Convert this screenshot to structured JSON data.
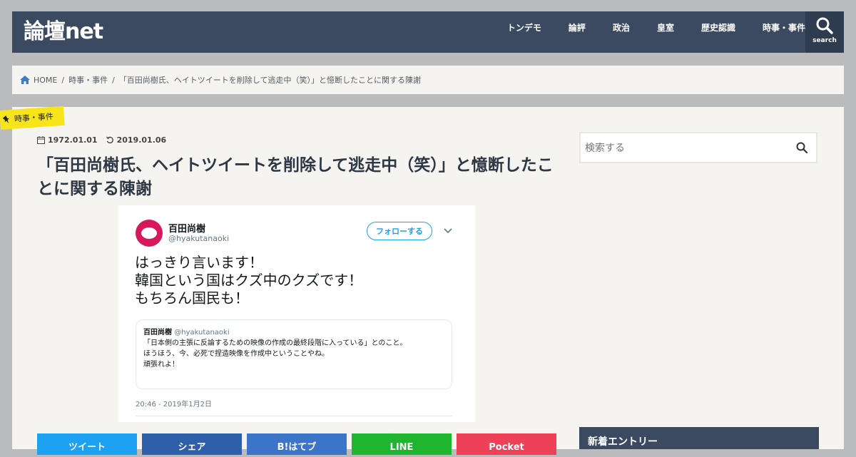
{
  "site": {
    "logo": "論壇net"
  },
  "nav": {
    "items": [
      "トンデモ",
      "論評",
      "政治",
      "皇室",
      "歴史認識",
      "時事・事件"
    ],
    "search_label": "search"
  },
  "breadcrumb": {
    "home": "HOME",
    "category": "時事・事件",
    "current": "「百田尚樹氏、ヘイトツイートを削除して逃走中（笑）」と憶断したことに関する陳謝"
  },
  "article": {
    "category": "時事・事件",
    "published": "1972.01.01",
    "updated": "2019.01.06",
    "title": "「百田尚樹氏、ヘイトツイートを削除して逃走中（笑）」と憶断したことに関する陳謝"
  },
  "tweet": {
    "name": "百田尚樹",
    "handle": "@hyakutanaoki",
    "follow_label": "フォローする",
    "lines": [
      "はっきり言います！",
      "韓国という国はクズ中のクズです！",
      "もちろん国民も！"
    ],
    "quote": {
      "name": "百田尚樹",
      "handle": "@hyakutanaoki",
      "lines": [
        "「日本側の主張に反論するための映像の作成の最終段階に入っている」とのこと。",
        "ほうほう、今、必死で捏造映像を作成中ということやね。",
        "頑張れよ！"
      ]
    },
    "timestamp": "20:46 - 2019年1月2日"
  },
  "share": {
    "buttons": [
      {
        "label": "ツイート",
        "color": "#1da1f2"
      },
      {
        "label": "シェア",
        "color": "#2e5fa8"
      },
      {
        "label": "B!はてブ",
        "color": "#3b74c8"
      },
      {
        "label": "LINE",
        "color": "#1fb52e"
      },
      {
        "label": "Pocket",
        "color": "#ee4056"
      }
    ]
  },
  "sidebar": {
    "search_placeholder": "検索する",
    "new_entries_title": "新着エントリー"
  },
  "colors": {
    "header_bg": "#3b4a60",
    "category_tag": "#f7e41a",
    "twitter_blue": "#1da1f2"
  }
}
